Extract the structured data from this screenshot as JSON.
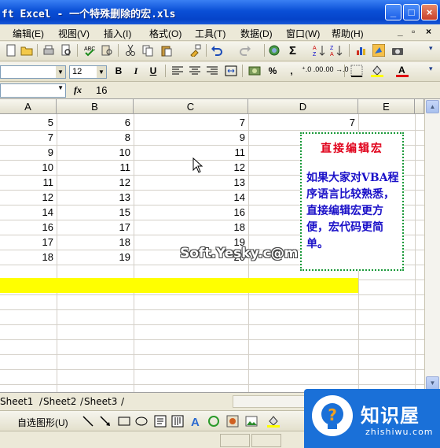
{
  "window": {
    "title": "ft Excel - 一个特殊删除的宏.xls",
    "minimize_glyph": "_",
    "maximize_glyph": "□",
    "close_glyph": "×"
  },
  "menu": {
    "items": [
      "编辑(E)",
      "视图(V)",
      "插入(I)",
      "格式(O)",
      "工具(T)",
      "数据(D)",
      "窗口(W)",
      "帮助(H)"
    ],
    "doc_restore_glyph": "▫",
    "doc_close_glyph": "×"
  },
  "format_toolbar": {
    "font_size": "12",
    "bold": "B",
    "italic": "I",
    "underline": "U",
    "percent": "%",
    "comma": ","
  },
  "formula_bar": {
    "fx_label": "fx",
    "value": "16"
  },
  "columns": [
    "A",
    "B",
    "C",
    "D",
    "E"
  ],
  "rows": [
    {
      "a": "5",
      "b": "6",
      "c": "7",
      "d": "7"
    },
    {
      "a": "7",
      "b": "8",
      "c": "9",
      "d": ""
    },
    {
      "a": "9",
      "b": "10",
      "c": "11",
      "d": ""
    },
    {
      "a": "10",
      "b": "11",
      "c": "12",
      "d": ""
    },
    {
      "a": "11",
      "b": "12",
      "c": "13",
      "d": ""
    },
    {
      "a": "12",
      "b": "13",
      "c": "14",
      "d": ""
    },
    {
      "a": "14",
      "b": "15",
      "c": "16",
      "d": ""
    },
    {
      "a": "16",
      "b": "17",
      "c": "18",
      "d": ""
    },
    {
      "a": "17",
      "b": "18",
      "c": "19",
      "d": ""
    },
    {
      "a": "18",
      "b": "19",
      "c": "20",
      "d": ""
    }
  ],
  "text_box": {
    "title": "直接编辑宏",
    "body": "如果大家对VBA程序语言比较熟悉，直接编辑宏更方便，宏代码更简单。"
  },
  "watermark": "Soft.Yesky.c@m",
  "sheet_tabs": [
    "Sheet1",
    "Sheet2",
    "Sheet3"
  ],
  "drawing_toolbar": {
    "autoshapes_label": "自选图形(U)"
  },
  "logo": {
    "name": "知识屋",
    "url_text": "zhishiwu.com",
    "symbol": "?"
  },
  "colors": {
    "title_bar": "#0a4fd6",
    "highlight_band": "#ffff00",
    "text_box_title": "#e0001a",
    "text_box_body": "#1a10c8",
    "text_box_border": "#1b9a3a",
    "logo_bg": "#1a70d8"
  }
}
